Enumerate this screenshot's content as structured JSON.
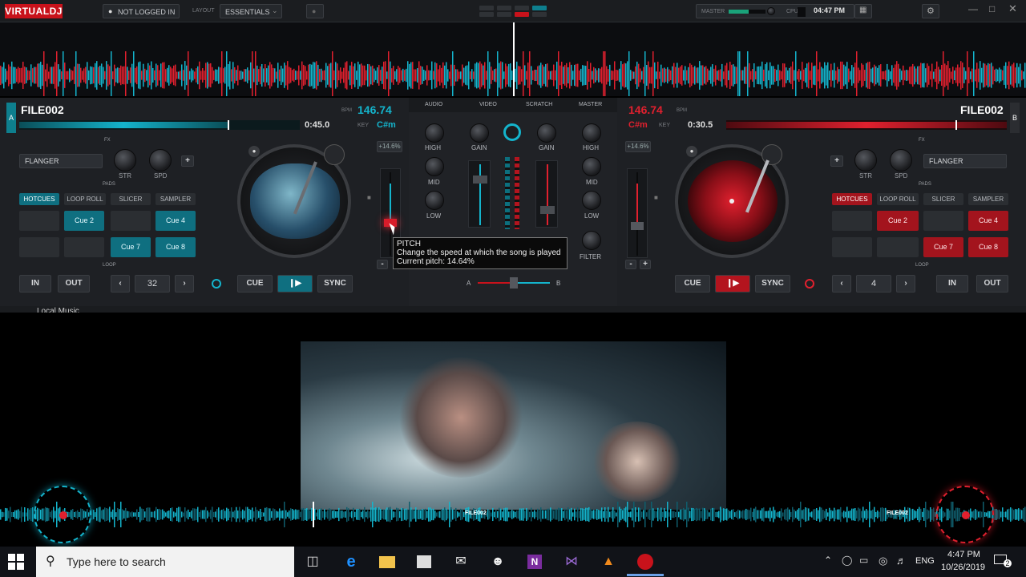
{
  "app": {
    "logo": "VIRTUALDJ",
    "login": "NOT LOGGED IN",
    "layout_label": "LAYOUT",
    "layout_value": "ESSENTIALS",
    "master_label": "MASTER",
    "cpu_label": "CPU",
    "clock": "04:47 PM"
  },
  "deck_a": {
    "letter": "A",
    "title": "FILE002",
    "bpm": "146.74",
    "bpm_label": "BPM",
    "time": "0:45.0",
    "key_label": "KEY",
    "key": "C#m",
    "pitch": "+14.6%",
    "fx_label": "FX",
    "fx": "FLANGER",
    "str": "STR",
    "spd": "SPD",
    "pads_label": "PADS",
    "tabs": [
      "HOTCUES",
      "LOOP ROLL",
      "SLICER",
      "SAMPLER"
    ],
    "pads": [
      "",
      "Cue 2",
      "",
      "Cue 4",
      "",
      "Cue 7",
      "Cue 8"
    ],
    "loop_label": "LOOP",
    "in": "IN",
    "out": "OUT",
    "loop": "32",
    "cue": "CUE",
    "sync": "SYNC",
    "minus": "-",
    "plus": "+"
  },
  "deck_b": {
    "letter": "B",
    "title": "FILE002",
    "bpm": "146.74",
    "bpm_label": "BPM",
    "time": "0:30.5",
    "key_label": "KEY",
    "key": "C#m",
    "pitch": "+14.6%",
    "fx_label": "FX",
    "fx": "FLANGER",
    "str": "STR",
    "spd": "SPD",
    "pads_label": "PADS",
    "tabs": [
      "HOTCUES",
      "LOOP ROLL",
      "SLICER",
      "SAMPLER"
    ],
    "pads": [
      "",
      "Cue 2",
      "",
      "Cue 4",
      "",
      "Cue 7",
      "Cue 8"
    ],
    "loop_label": "LOOP",
    "in": "IN",
    "out": "OUT",
    "loop": "4",
    "cue": "CUE",
    "sync": "SYNC",
    "minus": "-",
    "plus": "+"
  },
  "mixer": {
    "tabs": [
      "AUDIO",
      "VIDEO",
      "SCRATCH",
      "MASTER"
    ],
    "high": "HIGH",
    "mid": "MID",
    "low": "LOW",
    "gain": "GAIN",
    "filter": "FILTER",
    "a": "A",
    "b": "B"
  },
  "tooltip": {
    "title": "PITCH",
    "line1": "Change the speed at which the song is played",
    "line2": "Current pitch: 14.64%"
  },
  "browser": {
    "folder": "Local Music"
  },
  "video": {
    "label_a": "FILE002",
    "label_b": "FILE002"
  },
  "taskbar": {
    "search_placeholder": "Type here to search",
    "time": "4:47 PM",
    "date": "10/26/2019",
    "lang": "ENG",
    "notif": "2"
  },
  "colors": {
    "deck_a": "#14b4cc",
    "deck_b": "#e0202e"
  }
}
